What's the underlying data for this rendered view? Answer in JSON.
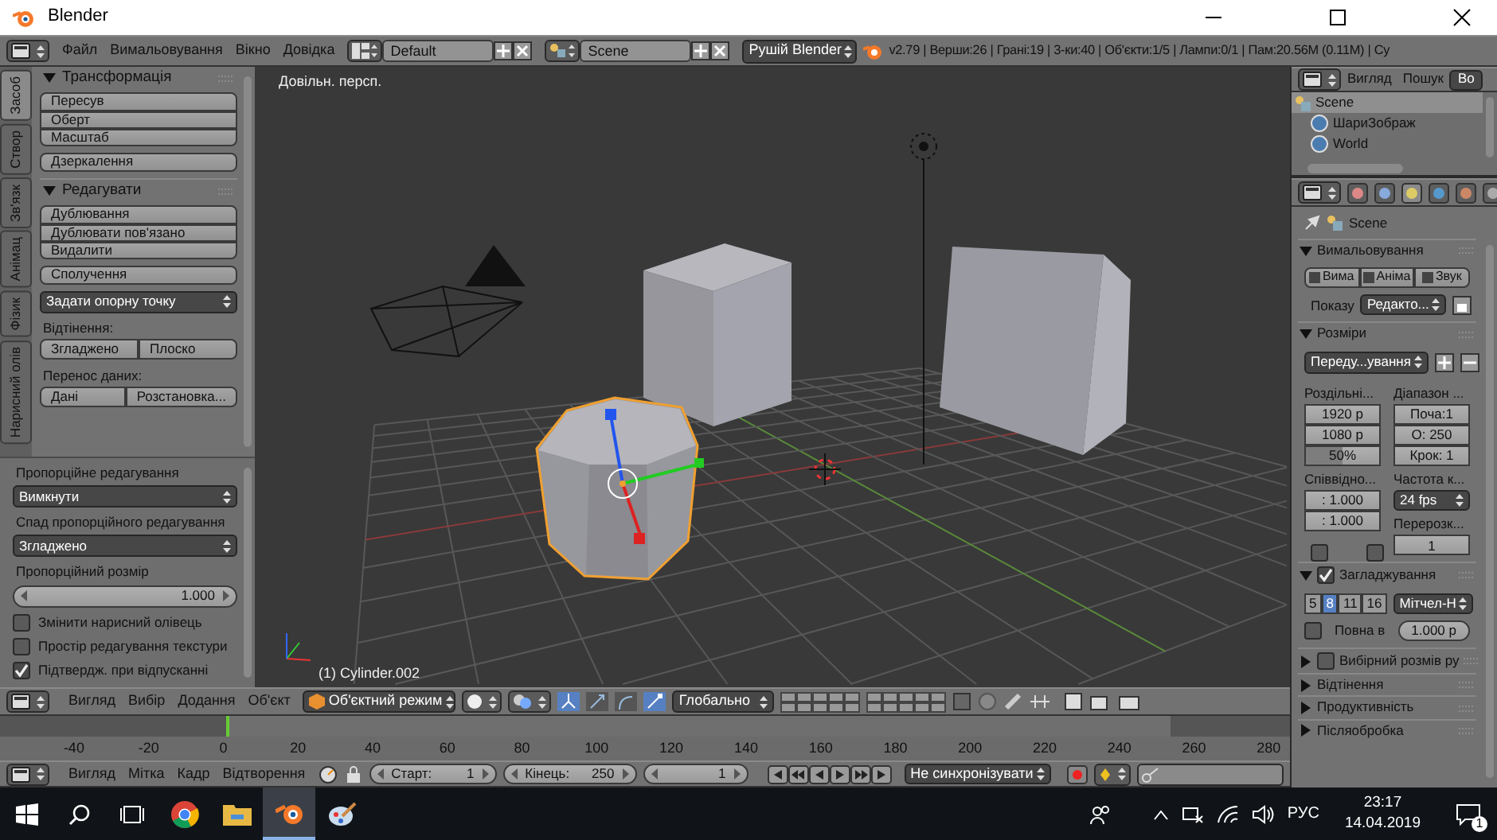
{
  "window": {
    "title": "Blender"
  },
  "info_header": {
    "menus": [
      "Файл",
      "Вимальовування",
      "Вікно",
      "Довідка"
    ],
    "layout": "Default",
    "scene": "Scene",
    "engine": "Рушій Blender",
    "stats": "v2.79 | Верши:26 | Грані:19 | 3-ки:40 | Об'єкти:1/5 | Лампи:0/1 | Пам:20.56M (0.11M) | Су"
  },
  "tool_shelf": {
    "tabs": [
      {
        "label": "Засоб",
        "selected": true
      },
      {
        "label": "Створ",
        "selected": false
      },
      {
        "label": "Зв'язк",
        "selected": false
      },
      {
        "label": "Анімац",
        "selected": false
      },
      {
        "label": "Фізик",
        "selected": false
      },
      {
        "label": "Нарисний олів",
        "selected": false
      }
    ],
    "panels": [
      {
        "title": "Трансформація",
        "expanded": true,
        "items": [
          {
            "kind": "column",
            "buttons": [
              "Пересув",
              "Оберт",
              "Масштаб"
            ]
          },
          {
            "kind": "column",
            "buttons": [
              "Дзеркалення"
            ]
          }
        ]
      },
      {
        "title": "Редагувати",
        "expanded": true,
        "items": [
          {
            "kind": "column",
            "buttons": [
              "Дублювання",
              "Дублювати пов'язано",
              "Видалити"
            ]
          },
          {
            "kind": "column",
            "buttons": [
              "Сполучення"
            ]
          },
          {
            "kind": "dropdown",
            "value": "Задати опорну точку"
          },
          {
            "kind": "label",
            "text": "Відтінення:"
          },
          {
            "kind": "row",
            "buttons": [
              "Згладжено",
              "Плоско"
            ]
          },
          {
            "kind": "label",
            "text": "Перенос даних:"
          },
          {
            "kind": "row",
            "buttons": [
              "Дані",
              "Розстановка..."
            ]
          }
        ]
      }
    ]
  },
  "operator_panel": {
    "items": [
      {
        "kind": "label",
        "text": "Пропорційне редагування"
      },
      {
        "kind": "dropdown",
        "value": "Вимкнути"
      },
      {
        "kind": "label",
        "text": "Спад пропорційного редагування"
      },
      {
        "kind": "dropdown",
        "value": "Згладжено"
      },
      {
        "kind": "label",
        "text": "Пропорційний розмір"
      },
      {
        "kind": "number",
        "value": "1.000"
      },
      {
        "kind": "checkbox",
        "text": "Змінити нарисний олівець",
        "checked": false
      },
      {
        "kind": "checkbox",
        "text": "Простір редагування текстури",
        "checked": false
      },
      {
        "kind": "checkbox",
        "text": "Підтвердж. при відпусканні",
        "checked": true
      }
    ]
  },
  "viewport": {
    "view_name": "Довільн. персп.",
    "object_name": "(1) Cylinder.002"
  },
  "view3d_header": {
    "menus": [
      "Вигляд",
      "Вибір",
      "Додання",
      "Об'єкт"
    ],
    "mode": "Об'єктний режим",
    "orientation": "Глобально"
  },
  "timeline": {
    "ticks": [
      "-40",
      "-20",
      "0",
      "20",
      "40",
      "60",
      "80",
      "100",
      "120",
      "140",
      "160",
      "180",
      "200",
      "220",
      "240",
      "260",
      "280"
    ]
  },
  "timeline_header": {
    "menus": [
      "Вигляд",
      "Мітка",
      "Кадр",
      "Відтворення"
    ],
    "start_label": "Старт:",
    "start": "1",
    "end_label": "Кінець:",
    "end": "250",
    "current": "1",
    "sync": "Не синхронізувати"
  },
  "outliner": {
    "menus": [
      "Вигляд",
      "Пошук"
    ],
    "filter": "Во",
    "items": [
      {
        "label": "Scene",
        "selected": true,
        "children": [
          {
            "label": "ШариЗображ",
            "selected": false
          },
          {
            "label": "World",
            "selected": false
          }
        ]
      }
    ]
  },
  "properties": {
    "context": "Scene",
    "panels": [
      {
        "title": "Вимальовування",
        "expanded": true,
        "items": [
          {
            "kind": "buttons",
            "buttons": [
              "Вима",
              "Аніма",
              "Звук"
            ]
          },
          {
            "kind": "labeled_dropdown",
            "label": "Показу",
            "value": "Редакто..."
          }
        ]
      },
      {
        "title": "Розміри",
        "expanded": true,
        "items": [
          {
            "kind": "preset",
            "value": "Переду...ування"
          },
          {
            "kind": "columns",
            "columns": [
              [
                {
                  "kind": "label",
                  "text": "Роздільні..."
                },
                {
                  "kind": "field",
                  "text": "1920 р"
                },
                {
                  "kind": "field",
                  "text": "1080 р"
                },
                {
                  "kind": "field",
                  "text": "50%",
                  "level": 0.5
                }
              ],
              [
                {
                  "kind": "label",
                  "text": "Діапазон ..."
                },
                {
                  "kind": "field",
                  "text": "Поча:1"
                },
                {
                  "kind": "field",
                  "text": "О: 250"
                },
                {
                  "kind": "field",
                  "text": "Крок: 1"
                }
              ]
            ]
          },
          {
            "kind": "columns",
            "columns": [
              [
                {
                  "kind": "label",
                  "text": "Співвідно..."
                },
                {
                  "kind": "field",
                  "text": ": 1.000"
                },
                {
                  "kind": "field",
                  "text": ": 1.000"
                },
                {
                  "kind": "checkboxes",
                  "checks": [
                    false,
                    false
                  ]
                }
              ],
              [
                {
                  "kind": "label",
                  "text": "Частота к..."
                },
                {
                  "kind": "dropdown",
                  "value": "24 fps"
                },
                {
                  "kind": "label",
                  "text": "Перерозк..."
                },
                {
                  "kind": "field",
                  "text": "1"
                }
              ]
            ]
          }
        ]
      },
      {
        "title": "Загладжування",
        "expanded": true,
        "checked": true,
        "items": [
          {
            "kind": "samples",
            "options": [
              {
                "label": "5",
                "selected": false
              },
              {
                "label": "8",
                "selected": true
              },
              {
                "label": "11",
                "selected": false
              },
              {
                "label": "16",
                "selected": false
              }
            ],
            "filter": "Мітчел-Н"
          },
          {
            "kind": "check_field",
            "checked": false,
            "label": "Повна в",
            "value": "1.000 р"
          }
        ]
      },
      {
        "title": "Вибірний розмів ру",
        "expanded": false,
        "checked": false
      },
      {
        "title": "Відтінення",
        "expanded": false
      },
      {
        "title": "Продуктивність",
        "expanded": false
      },
      {
        "title": "Післяобробка",
        "expanded": false
      }
    ]
  },
  "taskbar": {
    "language": "РУС",
    "time": "23:17",
    "date": "14.04.2019",
    "notifications": "1"
  }
}
